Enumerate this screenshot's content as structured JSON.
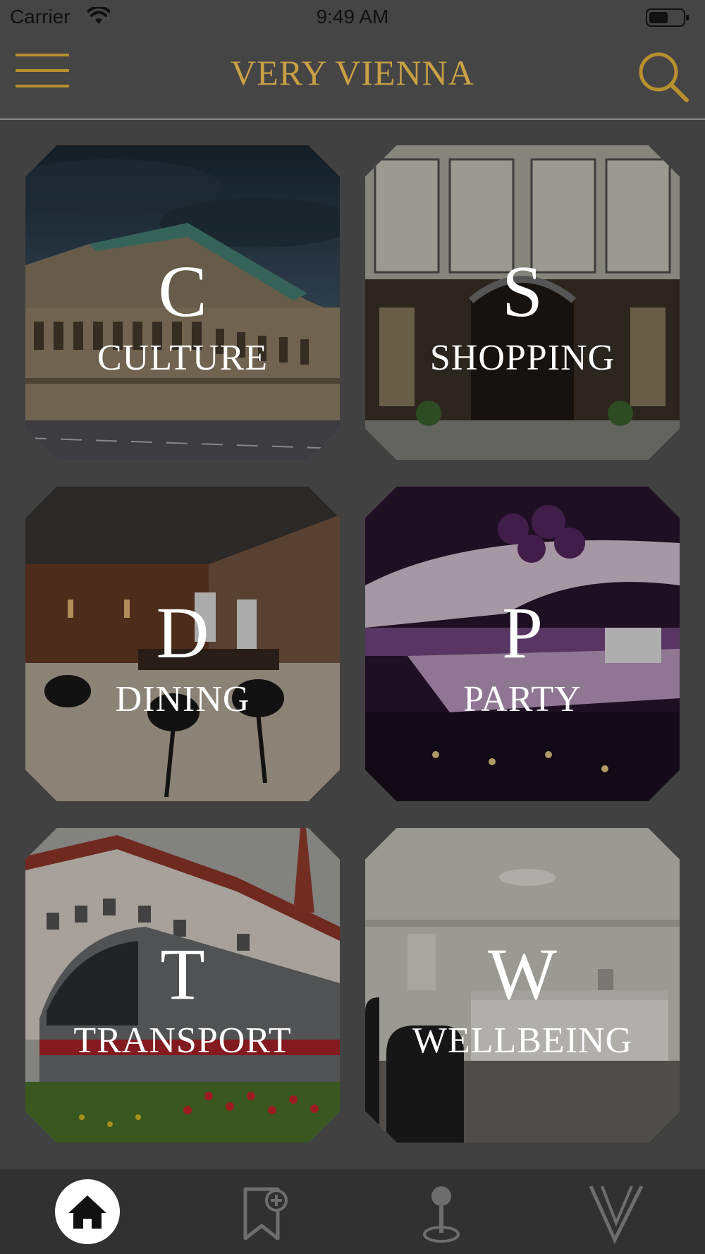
{
  "status_bar": {
    "carrier": "Carrier",
    "time": "9:49 AM",
    "icons": [
      "wifi-icon",
      "battery-icon"
    ]
  },
  "header": {
    "title": "VERY VIENNA",
    "menu_icon": "hamburger-menu-icon",
    "search_icon": "search-icon",
    "accent_color": "#c9a045"
  },
  "categories": [
    {
      "letter": "C",
      "label": "CULTURE"
    },
    {
      "letter": "S",
      "label": "SHOPPING"
    },
    {
      "letter": "D",
      "label": "DINING"
    },
    {
      "letter": "P",
      "label": "PARTY"
    },
    {
      "letter": "T",
      "label": "TRANSPORT"
    },
    {
      "letter": "W",
      "label": "WELLBEING"
    }
  ],
  "tab_bar": {
    "tabs": [
      {
        "icon": "home-icon",
        "selected": true
      },
      {
        "icon": "bookmark-add-icon",
        "selected": false
      },
      {
        "icon": "map-pin-icon",
        "selected": false
      },
      {
        "icon": "very-vienna-logo-icon",
        "selected": false
      }
    ]
  }
}
